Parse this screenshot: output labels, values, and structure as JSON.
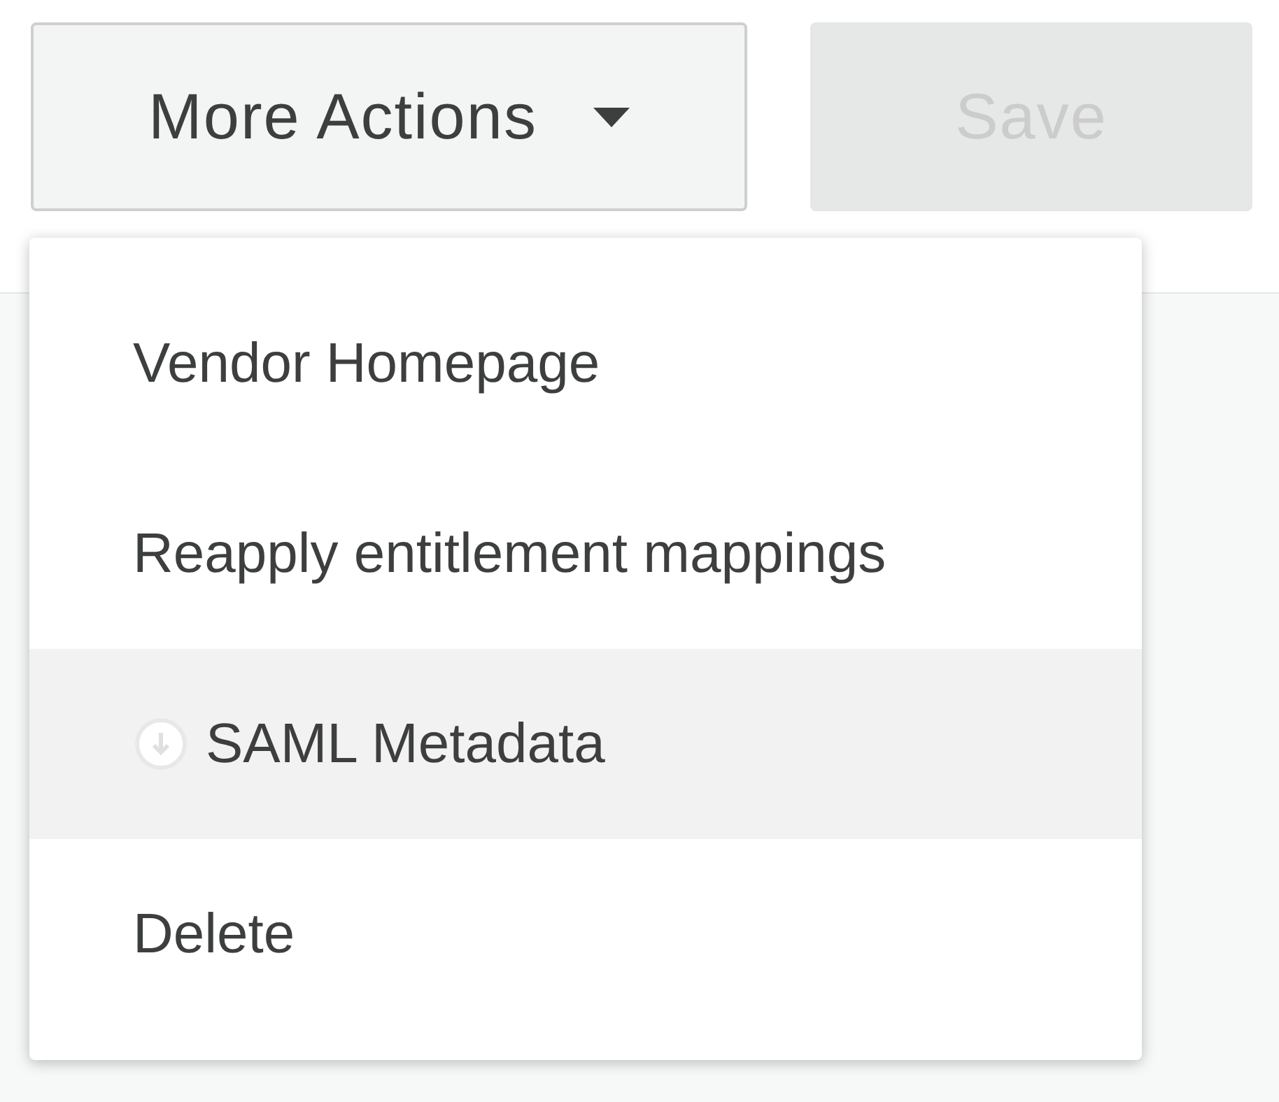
{
  "toolbar": {
    "more_actions": {
      "label": "More Actions",
      "expanded": true
    },
    "save": {
      "label": "Save",
      "disabled": true
    }
  },
  "menu": {
    "items": [
      {
        "label": "Vendor Homepage",
        "kind": "plain",
        "highlighted": false
      },
      {
        "label": "Reapply entitlement mappings",
        "kind": "plain",
        "highlighted": false
      },
      {
        "label": "SAML Metadata",
        "kind": "download",
        "highlighted": true
      },
      {
        "label": "Delete",
        "kind": "plain",
        "highlighted": false
      }
    ]
  }
}
